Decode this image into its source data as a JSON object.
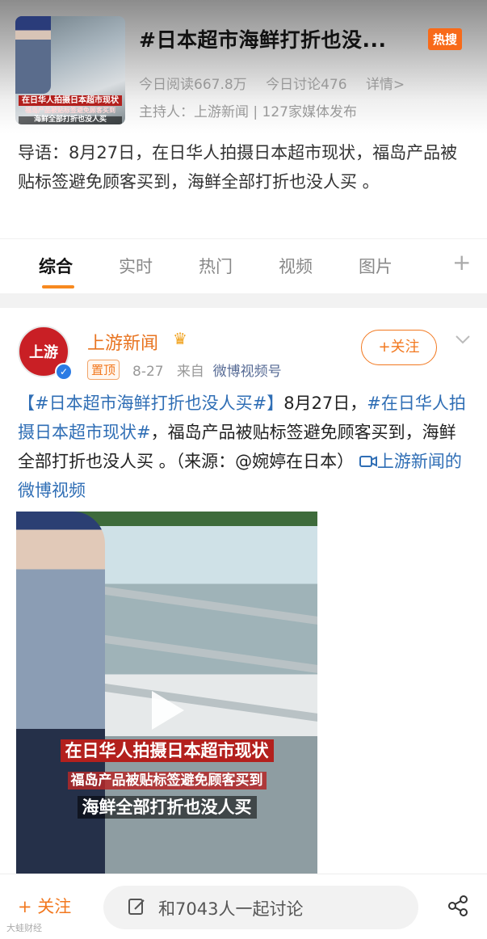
{
  "header": {
    "thumb_caption_1": "在日华人拍摄日本超市现状",
    "thumb_caption_2": "福岛产品被贴标签避免顾客买到",
    "thumb_caption_3": "海鲜全部打折也没人买",
    "title": "#日本超市海鲜打折也没...",
    "hot_badge": "热搜",
    "reads": "今日阅读667.8万",
    "discussions": "今日讨论476",
    "details_link": "详情>",
    "host": "主持人：上游新闻 | 127家媒体发布"
  },
  "intro": {
    "text": "导语：8月27日，在日华人拍摄日本超市现状，福岛产品被贴标签避免顾客买到，海鲜全部打折也没人买 。"
  },
  "tabs": [
    {
      "label": "综合",
      "active": true
    },
    {
      "label": "实时"
    },
    {
      "label": "热门"
    },
    {
      "label": "视频"
    },
    {
      "label": "图片"
    }
  ],
  "post": {
    "avatar_text": "上游",
    "author": "上游新闻",
    "pinned": "置顶",
    "date": "8-27",
    "from": "来自",
    "source": "微博视频号",
    "follow": "+关注",
    "text_tag1": "【#日本超市海鲜打折也没人买#】",
    "text_date": "8月27日，",
    "text_tag2": "#在日华人拍摄日本超市现状#",
    "text_body": "，福岛产品被贴标签避免顾客买到，海鲜全部打折也没人买 。（来源：@婉婷在日本）",
    "video_link": "上游新闻的微博视频",
    "video_caption_1": "在日华人拍摄日本超市现状",
    "video_caption_2": "福岛产品被贴标签避免顾客买到",
    "video_caption_3": "海鲜全部打折也没人买"
  },
  "bottom": {
    "follow": "+ 关注",
    "discuss": "和7043人一起讨论",
    "watermark": "大蛙财经"
  },
  "colors": {
    "accent": "#f2781f",
    "hot": "#f86a19",
    "link": "#2f6eb5"
  }
}
